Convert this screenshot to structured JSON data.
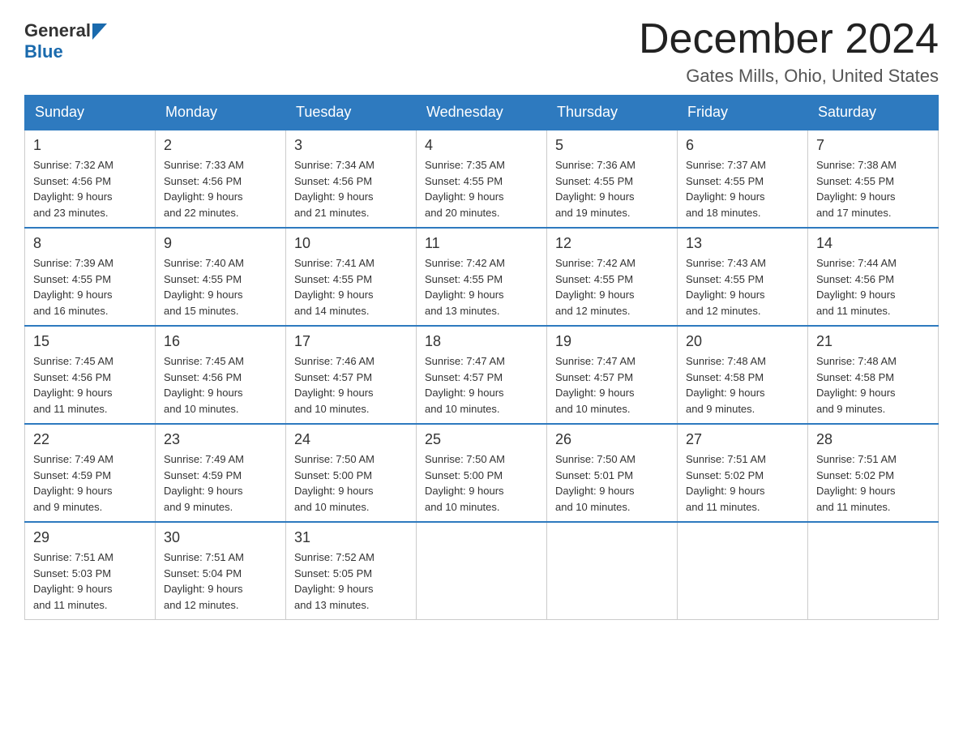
{
  "logo": {
    "general": "General",
    "blue": "Blue"
  },
  "title": {
    "month_year": "December 2024",
    "location": "Gates Mills, Ohio, United States"
  },
  "headers": [
    "Sunday",
    "Monday",
    "Tuesday",
    "Wednesday",
    "Thursday",
    "Friday",
    "Saturday"
  ],
  "weeks": [
    [
      {
        "day": "1",
        "sunrise": "Sunrise: 7:32 AM",
        "sunset": "Sunset: 4:56 PM",
        "daylight": "Daylight: 9 hours",
        "daylight2": "and 23 minutes."
      },
      {
        "day": "2",
        "sunrise": "Sunrise: 7:33 AM",
        "sunset": "Sunset: 4:56 PM",
        "daylight": "Daylight: 9 hours",
        "daylight2": "and 22 minutes."
      },
      {
        "day": "3",
        "sunrise": "Sunrise: 7:34 AM",
        "sunset": "Sunset: 4:56 PM",
        "daylight": "Daylight: 9 hours",
        "daylight2": "and 21 minutes."
      },
      {
        "day": "4",
        "sunrise": "Sunrise: 7:35 AM",
        "sunset": "Sunset: 4:55 PM",
        "daylight": "Daylight: 9 hours",
        "daylight2": "and 20 minutes."
      },
      {
        "day": "5",
        "sunrise": "Sunrise: 7:36 AM",
        "sunset": "Sunset: 4:55 PM",
        "daylight": "Daylight: 9 hours",
        "daylight2": "and 19 minutes."
      },
      {
        "day": "6",
        "sunrise": "Sunrise: 7:37 AM",
        "sunset": "Sunset: 4:55 PM",
        "daylight": "Daylight: 9 hours",
        "daylight2": "and 18 minutes."
      },
      {
        "day": "7",
        "sunrise": "Sunrise: 7:38 AM",
        "sunset": "Sunset: 4:55 PM",
        "daylight": "Daylight: 9 hours",
        "daylight2": "and 17 minutes."
      }
    ],
    [
      {
        "day": "8",
        "sunrise": "Sunrise: 7:39 AM",
        "sunset": "Sunset: 4:55 PM",
        "daylight": "Daylight: 9 hours",
        "daylight2": "and 16 minutes."
      },
      {
        "day": "9",
        "sunrise": "Sunrise: 7:40 AM",
        "sunset": "Sunset: 4:55 PM",
        "daylight": "Daylight: 9 hours",
        "daylight2": "and 15 minutes."
      },
      {
        "day": "10",
        "sunrise": "Sunrise: 7:41 AM",
        "sunset": "Sunset: 4:55 PM",
        "daylight": "Daylight: 9 hours",
        "daylight2": "and 14 minutes."
      },
      {
        "day": "11",
        "sunrise": "Sunrise: 7:42 AM",
        "sunset": "Sunset: 4:55 PM",
        "daylight": "Daylight: 9 hours",
        "daylight2": "and 13 minutes."
      },
      {
        "day": "12",
        "sunrise": "Sunrise: 7:42 AM",
        "sunset": "Sunset: 4:55 PM",
        "daylight": "Daylight: 9 hours",
        "daylight2": "and 12 minutes."
      },
      {
        "day": "13",
        "sunrise": "Sunrise: 7:43 AM",
        "sunset": "Sunset: 4:55 PM",
        "daylight": "Daylight: 9 hours",
        "daylight2": "and 12 minutes."
      },
      {
        "day": "14",
        "sunrise": "Sunrise: 7:44 AM",
        "sunset": "Sunset: 4:56 PM",
        "daylight": "Daylight: 9 hours",
        "daylight2": "and 11 minutes."
      }
    ],
    [
      {
        "day": "15",
        "sunrise": "Sunrise: 7:45 AM",
        "sunset": "Sunset: 4:56 PM",
        "daylight": "Daylight: 9 hours",
        "daylight2": "and 11 minutes."
      },
      {
        "day": "16",
        "sunrise": "Sunrise: 7:45 AM",
        "sunset": "Sunset: 4:56 PM",
        "daylight": "Daylight: 9 hours",
        "daylight2": "and 10 minutes."
      },
      {
        "day": "17",
        "sunrise": "Sunrise: 7:46 AM",
        "sunset": "Sunset: 4:57 PM",
        "daylight": "Daylight: 9 hours",
        "daylight2": "and 10 minutes."
      },
      {
        "day": "18",
        "sunrise": "Sunrise: 7:47 AM",
        "sunset": "Sunset: 4:57 PM",
        "daylight": "Daylight: 9 hours",
        "daylight2": "and 10 minutes."
      },
      {
        "day": "19",
        "sunrise": "Sunrise: 7:47 AM",
        "sunset": "Sunset: 4:57 PM",
        "daylight": "Daylight: 9 hours",
        "daylight2": "and 10 minutes."
      },
      {
        "day": "20",
        "sunrise": "Sunrise: 7:48 AM",
        "sunset": "Sunset: 4:58 PM",
        "daylight": "Daylight: 9 hours",
        "daylight2": "and 9 minutes."
      },
      {
        "day": "21",
        "sunrise": "Sunrise: 7:48 AM",
        "sunset": "Sunset: 4:58 PM",
        "daylight": "Daylight: 9 hours",
        "daylight2": "and 9 minutes."
      }
    ],
    [
      {
        "day": "22",
        "sunrise": "Sunrise: 7:49 AM",
        "sunset": "Sunset: 4:59 PM",
        "daylight": "Daylight: 9 hours",
        "daylight2": "and 9 minutes."
      },
      {
        "day": "23",
        "sunrise": "Sunrise: 7:49 AM",
        "sunset": "Sunset: 4:59 PM",
        "daylight": "Daylight: 9 hours",
        "daylight2": "and 9 minutes."
      },
      {
        "day": "24",
        "sunrise": "Sunrise: 7:50 AM",
        "sunset": "Sunset: 5:00 PM",
        "daylight": "Daylight: 9 hours",
        "daylight2": "and 10 minutes."
      },
      {
        "day": "25",
        "sunrise": "Sunrise: 7:50 AM",
        "sunset": "Sunset: 5:00 PM",
        "daylight": "Daylight: 9 hours",
        "daylight2": "and 10 minutes."
      },
      {
        "day": "26",
        "sunrise": "Sunrise: 7:50 AM",
        "sunset": "Sunset: 5:01 PM",
        "daylight": "Daylight: 9 hours",
        "daylight2": "and 10 minutes."
      },
      {
        "day": "27",
        "sunrise": "Sunrise: 7:51 AM",
        "sunset": "Sunset: 5:02 PM",
        "daylight": "Daylight: 9 hours",
        "daylight2": "and 11 minutes."
      },
      {
        "day": "28",
        "sunrise": "Sunrise: 7:51 AM",
        "sunset": "Sunset: 5:02 PM",
        "daylight": "Daylight: 9 hours",
        "daylight2": "and 11 minutes."
      }
    ],
    [
      {
        "day": "29",
        "sunrise": "Sunrise: 7:51 AM",
        "sunset": "Sunset: 5:03 PM",
        "daylight": "Daylight: 9 hours",
        "daylight2": "and 11 minutes."
      },
      {
        "day": "30",
        "sunrise": "Sunrise: 7:51 AM",
        "sunset": "Sunset: 5:04 PM",
        "daylight": "Daylight: 9 hours",
        "daylight2": "and 12 minutes."
      },
      {
        "day": "31",
        "sunrise": "Sunrise: 7:52 AM",
        "sunset": "Sunset: 5:05 PM",
        "daylight": "Daylight: 9 hours",
        "daylight2": "and 13 minutes."
      },
      null,
      null,
      null,
      null
    ]
  ]
}
